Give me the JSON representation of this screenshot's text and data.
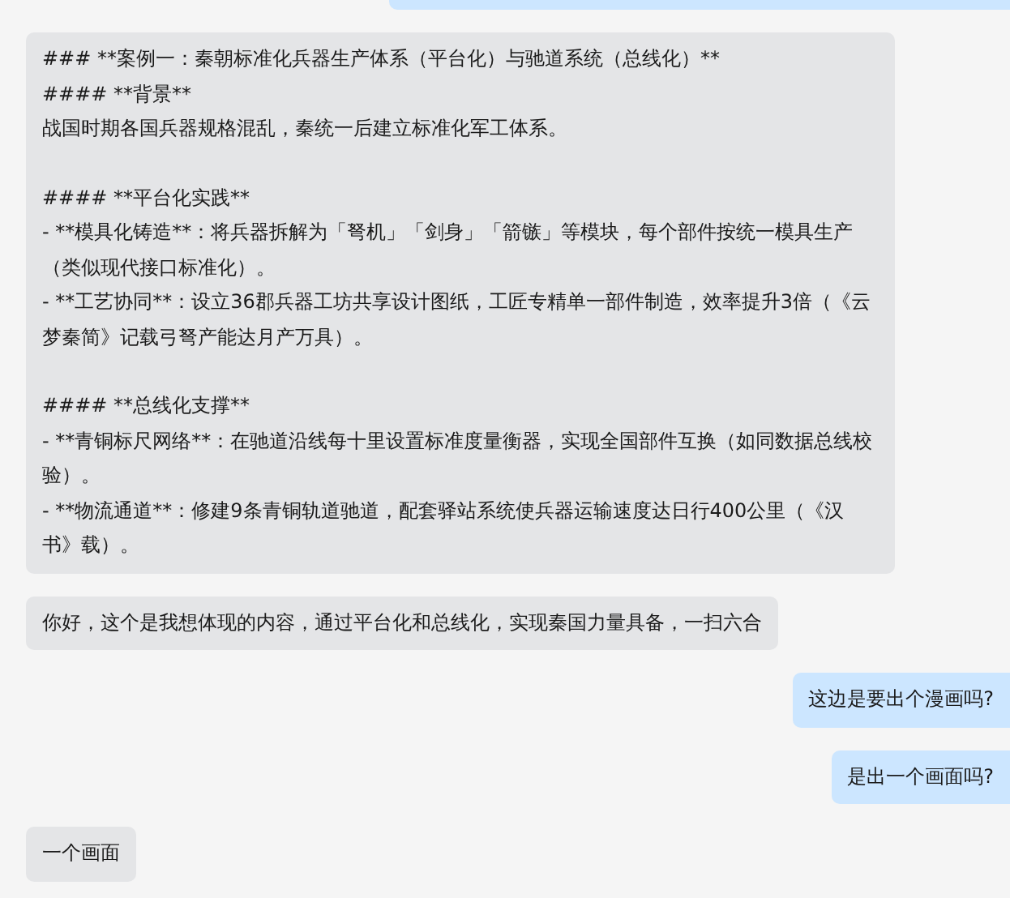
{
  "messages": [
    {
      "kind": "outgoing"
    },
    {
      "kind": "incoming",
      "blocks": [
        [
          "### **案例一：秦朝标准化兵器生产体系（平台化）与驰道系统（总线化）**",
          "#### **背景**",
          "战国时期各国兵器规格混乱，秦统一后建立标准化军工体系。"
        ],
        [
          "#### **平台化实践**",
          "- **模具化铸造**：将兵器拆解为「弩机」「剑身」「箭镞」等模块，每个部件按统一模具生产（类似现代接口标准化）。",
          "- **工艺协同**：设立36郡兵器工坊共享设计图纸，工匠专精单一部件制造，效率提升3倍（《云梦秦简》记载弓弩产能达月产万具）。"
        ],
        [
          "#### **总线化支撑**",
          "- **青铜标尺网络**：在驰道沿线每十里设置标准度量衡器，实现全国部件互换（如同数据总线校验）。",
          "- **物流通道**：修建9条青铜轨道驰道，配套驿站系统使兵器运输速度达日行400公里（《汉书》载）。"
        ]
      ]
    },
    {
      "kind": "incoming",
      "blocks": [
        [
          "你好，这个是我想体现的内容，通过平台化和总线化，实现秦国力量具备，一扫六合"
        ]
      ]
    },
    {
      "kind": "outgoing",
      "blocks": [
        [
          "这边是要出个漫画吗?"
        ]
      ]
    },
    {
      "kind": "outgoing",
      "blocks": [
        [
          "是出一个画面吗?"
        ]
      ]
    },
    {
      "kind": "incoming",
      "blocks": [
        [
          "一个画面"
        ]
      ]
    }
  ]
}
